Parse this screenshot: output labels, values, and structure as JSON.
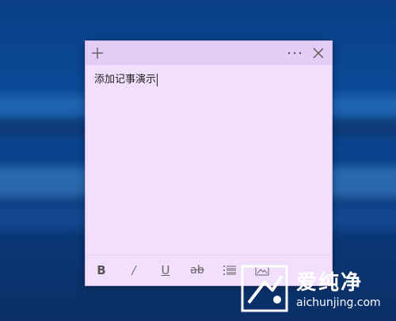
{
  "note": {
    "content": "添加记事演示",
    "background_color": "#f2dffc",
    "titlebar_color": "#e4cdf5",
    "titlebar": {
      "add_icon": "plus-icon",
      "more_icon": "ellipsis-icon",
      "close_icon": "close-icon"
    },
    "toolbar": {
      "bold_label": "B",
      "italic_label": "/",
      "underline_label": "U",
      "strikethrough_label": "ab",
      "list_icon": "bullet-list-icon",
      "image_icon": "image-icon"
    }
  },
  "watermark": {
    "title": "爱纯净",
    "url": "aichunjing.com"
  }
}
